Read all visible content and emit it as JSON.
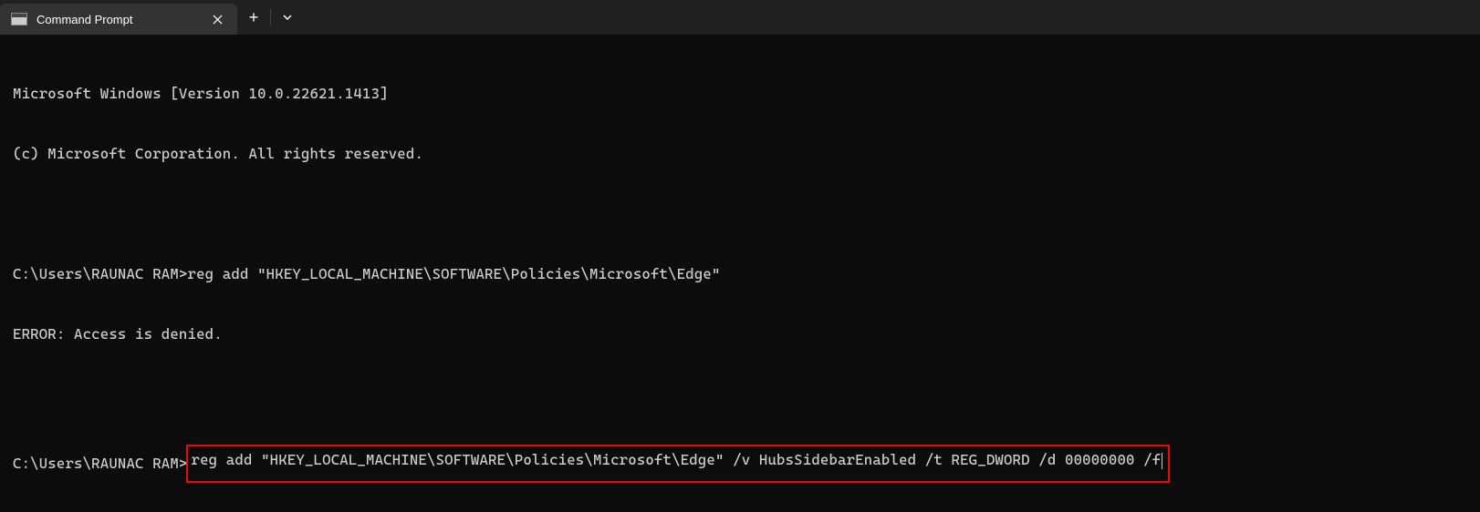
{
  "titlebar": {
    "tab_title": "Command Prompt"
  },
  "terminal": {
    "line1": "Microsoft Windows [Version 10.0.22621.1413]",
    "line2": "(c) Microsoft Corporation. All rights reserved.",
    "prompt1": "C:\\Users\\RAUNAC RAM>",
    "cmd1": "reg add \"HKEY_LOCAL_MACHINE\\SOFTWARE\\Policies\\Microsoft\\Edge\"",
    "error1": "ERROR: Access is denied.",
    "prompt2": "C:\\Users\\RAUNAC RAM>",
    "cmd2": "reg add \"HKEY_LOCAL_MACHINE\\SOFTWARE\\Policies\\Microsoft\\Edge\" /v HubsSidebarEnabled /t REG_DWORD /d 00000000 /f"
  }
}
